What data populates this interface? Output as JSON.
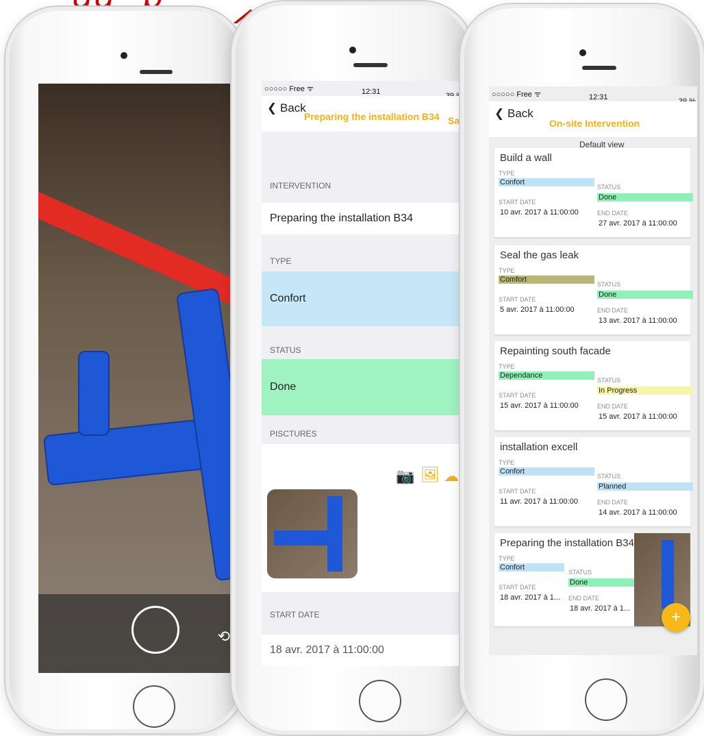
{
  "phone2": {
    "carrier": "○○○○○ Free ᯤ",
    "time": "12:31",
    "battery": "39 %",
    "back_label": "Back",
    "title": "Preparing the installation B34",
    "save_label": "Sa",
    "intervention_header": "INTERVENTION",
    "intervention_value": "Preparing the installation B34",
    "type_header": "TYPE",
    "type_value": "Confort",
    "status_header": "STATUS",
    "status_value": "Done",
    "pictures_header": "PISCTURES",
    "start_date_header": "START DATE",
    "start_date_value": "18 avr. 2017 à 11:00:00"
  },
  "phone3": {
    "carrier": "○○○○○ Free ᯤ",
    "time": "12:31",
    "battery": "39 %",
    "back_label": "Back",
    "title": "On-site Intervention",
    "subtitle": "Default view",
    "labels": {
      "type": "TYPE",
      "status": "STATUS",
      "start_date": "START DATE",
      "end_date": "END DATE"
    },
    "cards": [
      {
        "title": "Build a wall",
        "type": "Confort",
        "type_color": "#bfe2f7",
        "status": "Done",
        "status_color": "#90f1b8",
        "start": "10 avr. 2017 à 11:00:00",
        "end": "27 avr. 2017 à 11:00:00"
      },
      {
        "title": "Seal the gas leak",
        "type": "Comfort",
        "type_color": "#b7b776",
        "status": "Done",
        "status_color": "#90f1b8",
        "start": "5 avr. 2017 à 11:00:00",
        "end": "13 avr. 2017 à 11:00:00"
      },
      {
        "title": "Repainting south facade",
        "type": "Dependance",
        "type_color": "#90f1b8",
        "status": "In Progress",
        "status_color": "#f6f6a8",
        "start": "15 avr. 2017 à 11:00:00",
        "end": "15 avr. 2017 à 11:00:00"
      },
      {
        "title": "installation excell",
        "type": "Confort",
        "type_color": "#bfe2f7",
        "status": "Planned",
        "status_color": "#bfe2f7",
        "start": "11 avr. 2017 à 11:00:00",
        "end": "14 avr. 2017 à 11:00:00"
      },
      {
        "title": "Preparing the installation B34",
        "type": "Confort",
        "type_color": "#bfe2f7",
        "status": "Done",
        "status_color": "#90f1b8",
        "start": "18 avr. 2017 à 1...",
        "end": "18 avr. 2017 à 1..."
      }
    ],
    "fab_label": "+"
  },
  "colors": {
    "accent_yellow": "#f1b11a",
    "type_blue": "#c6e7f7",
    "status_green": "#9ff3c0",
    "fab_orange": "#f6b918"
  }
}
